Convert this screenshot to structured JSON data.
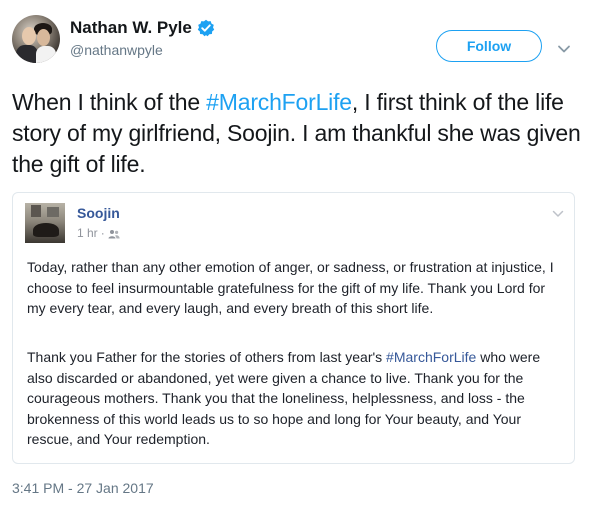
{
  "author": {
    "display_name": "Nathan W. Pyle",
    "handle": "@nathanwpyle",
    "verified": true
  },
  "follow_label": "Follow",
  "tweet": {
    "text_before": "When I think of the ",
    "hashtag": "#MarchForLife",
    "text_after": ", I first think of the life story of my girlfriend, Soojin. I am thankful she was given the gift of life."
  },
  "embed": {
    "name": "Soojin",
    "time": "1 hr",
    "separator": "·",
    "audience_icon": "friends-icon",
    "paragraph1": "Today, rather than any other emotion of anger, or sadness, or frustration at injustice, I choose to feel insurmountable gratefulness for the gift of my life. Thank you Lord for my every tear, and every laugh, and every breath of this short life.",
    "paragraph2_before": "Thank you Father for the stories of others from last year's ",
    "paragraph2_hashtag": "#MarchForLife",
    "paragraph2_after": " who were also discarded or abandoned, yet were given a chance to live. Thank you for the courageous mothers. Thank you that the loneliness, helplessness, and loss - the brokenness of this world leads us to so hope and long for Your beauty, and Your rescue, and Your redemption."
  },
  "timestamp": "3:41 PM - 27 Jan 2017",
  "colors": {
    "accent": "#1da1f2",
    "facebook_link": "#365899",
    "secondary_text": "#657786"
  }
}
